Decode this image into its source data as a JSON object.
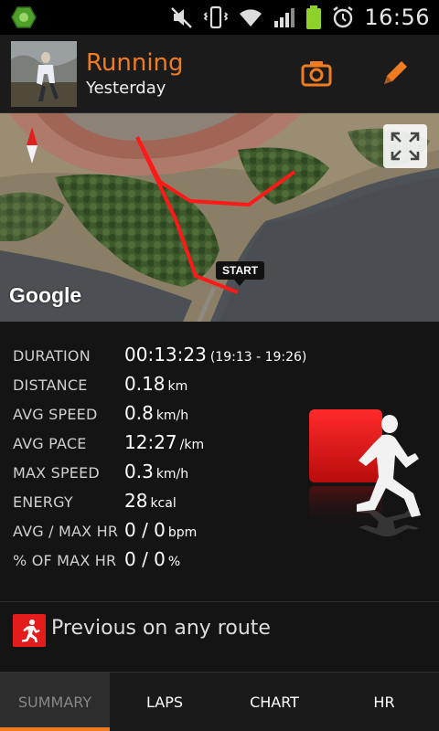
{
  "status": {
    "time": "16:56"
  },
  "header": {
    "title": "Running",
    "subtitle": "Yesterday"
  },
  "map": {
    "start_label": "START",
    "google_logo": "Google"
  },
  "stats": {
    "duration": {
      "label": "DURATION",
      "value": "00:13:23",
      "extra": "(19:13 - 19:26)"
    },
    "distance": {
      "label": "DISTANCE",
      "value": "0.18",
      "unit": "km"
    },
    "avg_speed": {
      "label": "AVG SPEED",
      "value": "0.8",
      "unit": "km/h"
    },
    "avg_pace": {
      "label": "AVG PACE",
      "value": "12:27",
      "unit": "/km"
    },
    "max_speed": {
      "label": "MAX SPEED",
      "value": "0.3",
      "unit": "km/h"
    },
    "energy": {
      "label": "ENERGY",
      "value": "28",
      "unit": "kcal"
    },
    "avg_max_hr": {
      "label": "AVG / MAX HR",
      "value": "0 / 0",
      "unit": "bpm"
    },
    "pct_max_hr": {
      "label": "% OF MAX HR",
      "value": "0 / 0",
      "unit": "%"
    }
  },
  "previous": {
    "label": "Previous on any route"
  },
  "tabs": [
    {
      "label": "SUMMARY",
      "active": true
    },
    {
      "label": "LAPS"
    },
    {
      "label": "CHART"
    },
    {
      "label": "HR"
    }
  ],
  "colors": {
    "accent": "#f07c22",
    "route": "#ff1a1a",
    "brand_red": "#e41c1c"
  }
}
